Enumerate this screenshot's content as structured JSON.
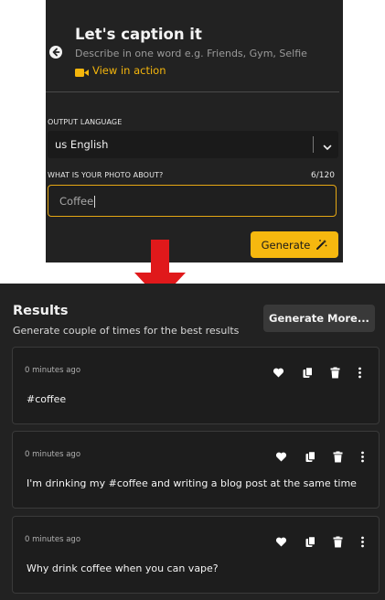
{
  "header": {
    "title": "Let's caption it",
    "description": "Describe in one word e.g. Friends, Gym, Selfie",
    "view_link": "View in action"
  },
  "form": {
    "language_label": "OUTPUT LANGUAGE",
    "language_value": "us English",
    "topic_label": "WHAT IS YOUR PHOTO ABOUT?",
    "char_count": "6/120",
    "topic_value": "Coffee",
    "generate_label": "Generate"
  },
  "results": {
    "title": "Results",
    "subtitle": "Generate couple of times for the best results",
    "more_label": "Generate More...",
    "items": [
      {
        "time": "0 minutes ago",
        "text": "#coffee"
      },
      {
        "time": "0 minutes ago",
        "text": "I'm drinking my #coffee and writing a blog post at the same time"
      },
      {
        "time": "0 minutes ago",
        "text": "Why drink coffee when you can vape?"
      }
    ]
  },
  "colors": {
    "panel": "#222222",
    "accent": "#f6b80f",
    "arrow": "#e0191b"
  },
  "icons": [
    "back-arrow-icon",
    "video-icon",
    "chevron-down-icon",
    "magic-wand-icon",
    "heart-icon",
    "copy-icon",
    "trash-icon",
    "more-vertical-icon",
    "down-arrow-icon"
  ]
}
